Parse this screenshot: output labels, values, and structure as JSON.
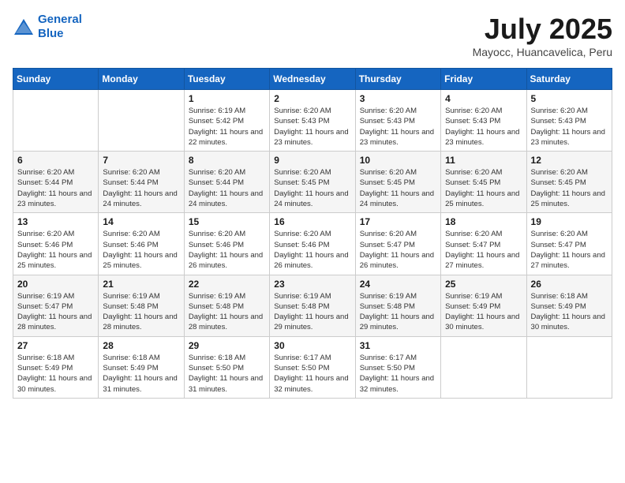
{
  "header": {
    "logo_line1": "General",
    "logo_line2": "Blue",
    "title": "July 2025",
    "location": "Mayocc, Huancavelica, Peru"
  },
  "weekdays": [
    "Sunday",
    "Monday",
    "Tuesday",
    "Wednesday",
    "Thursday",
    "Friday",
    "Saturday"
  ],
  "weeks": [
    [
      {
        "day": "",
        "info": ""
      },
      {
        "day": "",
        "info": ""
      },
      {
        "day": "1",
        "info": "Sunrise: 6:19 AM\nSunset: 5:42 PM\nDaylight: 11 hours and 22 minutes."
      },
      {
        "day": "2",
        "info": "Sunrise: 6:20 AM\nSunset: 5:43 PM\nDaylight: 11 hours and 23 minutes."
      },
      {
        "day": "3",
        "info": "Sunrise: 6:20 AM\nSunset: 5:43 PM\nDaylight: 11 hours and 23 minutes."
      },
      {
        "day": "4",
        "info": "Sunrise: 6:20 AM\nSunset: 5:43 PM\nDaylight: 11 hours and 23 minutes."
      },
      {
        "day": "5",
        "info": "Sunrise: 6:20 AM\nSunset: 5:43 PM\nDaylight: 11 hours and 23 minutes."
      }
    ],
    [
      {
        "day": "6",
        "info": "Sunrise: 6:20 AM\nSunset: 5:44 PM\nDaylight: 11 hours and 23 minutes."
      },
      {
        "day": "7",
        "info": "Sunrise: 6:20 AM\nSunset: 5:44 PM\nDaylight: 11 hours and 24 minutes."
      },
      {
        "day": "8",
        "info": "Sunrise: 6:20 AM\nSunset: 5:44 PM\nDaylight: 11 hours and 24 minutes."
      },
      {
        "day": "9",
        "info": "Sunrise: 6:20 AM\nSunset: 5:45 PM\nDaylight: 11 hours and 24 minutes."
      },
      {
        "day": "10",
        "info": "Sunrise: 6:20 AM\nSunset: 5:45 PM\nDaylight: 11 hours and 24 minutes."
      },
      {
        "day": "11",
        "info": "Sunrise: 6:20 AM\nSunset: 5:45 PM\nDaylight: 11 hours and 25 minutes."
      },
      {
        "day": "12",
        "info": "Sunrise: 6:20 AM\nSunset: 5:45 PM\nDaylight: 11 hours and 25 minutes."
      }
    ],
    [
      {
        "day": "13",
        "info": "Sunrise: 6:20 AM\nSunset: 5:46 PM\nDaylight: 11 hours and 25 minutes."
      },
      {
        "day": "14",
        "info": "Sunrise: 6:20 AM\nSunset: 5:46 PM\nDaylight: 11 hours and 25 minutes."
      },
      {
        "day": "15",
        "info": "Sunrise: 6:20 AM\nSunset: 5:46 PM\nDaylight: 11 hours and 26 minutes."
      },
      {
        "day": "16",
        "info": "Sunrise: 6:20 AM\nSunset: 5:46 PM\nDaylight: 11 hours and 26 minutes."
      },
      {
        "day": "17",
        "info": "Sunrise: 6:20 AM\nSunset: 5:47 PM\nDaylight: 11 hours and 26 minutes."
      },
      {
        "day": "18",
        "info": "Sunrise: 6:20 AM\nSunset: 5:47 PM\nDaylight: 11 hours and 27 minutes."
      },
      {
        "day": "19",
        "info": "Sunrise: 6:20 AM\nSunset: 5:47 PM\nDaylight: 11 hours and 27 minutes."
      }
    ],
    [
      {
        "day": "20",
        "info": "Sunrise: 6:19 AM\nSunset: 5:47 PM\nDaylight: 11 hours and 28 minutes."
      },
      {
        "day": "21",
        "info": "Sunrise: 6:19 AM\nSunset: 5:48 PM\nDaylight: 11 hours and 28 minutes."
      },
      {
        "day": "22",
        "info": "Sunrise: 6:19 AM\nSunset: 5:48 PM\nDaylight: 11 hours and 28 minutes."
      },
      {
        "day": "23",
        "info": "Sunrise: 6:19 AM\nSunset: 5:48 PM\nDaylight: 11 hours and 29 minutes."
      },
      {
        "day": "24",
        "info": "Sunrise: 6:19 AM\nSunset: 5:48 PM\nDaylight: 11 hours and 29 minutes."
      },
      {
        "day": "25",
        "info": "Sunrise: 6:19 AM\nSunset: 5:49 PM\nDaylight: 11 hours and 30 minutes."
      },
      {
        "day": "26",
        "info": "Sunrise: 6:18 AM\nSunset: 5:49 PM\nDaylight: 11 hours and 30 minutes."
      }
    ],
    [
      {
        "day": "27",
        "info": "Sunrise: 6:18 AM\nSunset: 5:49 PM\nDaylight: 11 hours and 30 minutes."
      },
      {
        "day": "28",
        "info": "Sunrise: 6:18 AM\nSunset: 5:49 PM\nDaylight: 11 hours and 31 minutes."
      },
      {
        "day": "29",
        "info": "Sunrise: 6:18 AM\nSunset: 5:50 PM\nDaylight: 11 hours and 31 minutes."
      },
      {
        "day": "30",
        "info": "Sunrise: 6:17 AM\nSunset: 5:50 PM\nDaylight: 11 hours and 32 minutes."
      },
      {
        "day": "31",
        "info": "Sunrise: 6:17 AM\nSunset: 5:50 PM\nDaylight: 11 hours and 32 minutes."
      },
      {
        "day": "",
        "info": ""
      },
      {
        "day": "",
        "info": ""
      }
    ]
  ]
}
